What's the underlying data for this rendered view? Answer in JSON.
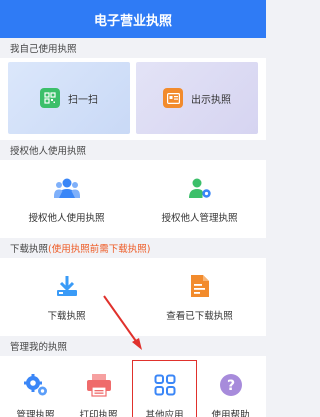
{
  "header": {
    "title": "电子营业执照"
  },
  "sections": {
    "self": {
      "title": "我自己使用执照",
      "scan_label": "扫一扫",
      "show_label": "出示执照"
    },
    "authorize": {
      "title": "授权他人使用执照",
      "items": [
        {
          "label": "授权他人使用执照",
          "icon": "people-icon"
        },
        {
          "label": "授权他人管理执照",
          "icon": "person-gear-icon"
        }
      ]
    },
    "download": {
      "title": "下载执照",
      "note": "(使用执照前需下载执照)",
      "items": [
        {
          "label": "下载执照",
          "icon": "download-icon"
        },
        {
          "label": "查看已下载执照",
          "icon": "document-icon"
        }
      ]
    },
    "manage": {
      "title": "管理我的执照",
      "items": [
        {
          "label": "管理执照",
          "icon": "gears-icon"
        },
        {
          "label": "打印执照",
          "icon": "printer-icon"
        },
        {
          "label": "其他应用",
          "icon": "apps-grid-icon",
          "highlighted": true
        },
        {
          "label": "使用帮助",
          "icon": "help-icon"
        }
      ]
    }
  },
  "colors": {
    "header": "#2f7bf5",
    "accent_blue": "#3a86f7",
    "accent_orange": "#f28b2c",
    "scan_green": "#3cbf6a",
    "warn": "#ee5a24",
    "highlight_red": "#e0312c",
    "help_purple": "#a78bdb"
  }
}
